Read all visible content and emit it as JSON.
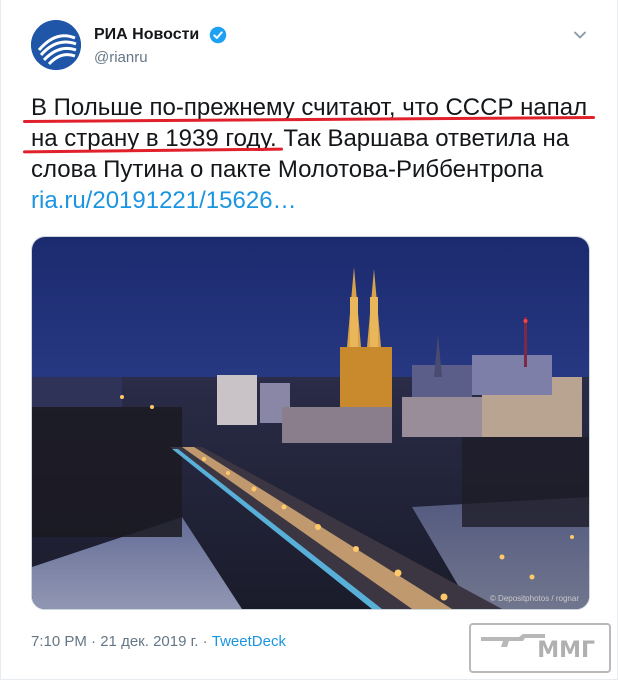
{
  "account": {
    "display_name": "РИА Новости",
    "handle": "@rianru",
    "verified": true
  },
  "tweet": {
    "lines": [
      "В Польше по-прежнему считают, что СССР напал",
      "на страну в 1939 году. Так Варшава ответила на",
      "слова Путина о пакте Молотова-Риббентропа"
    ],
    "link_text": "ria.ru/20191221/15626…"
  },
  "media": {
    "photo_credit": "© Depositphotos / rognar"
  },
  "footer": {
    "time": "7:10 PM",
    "separator": "·",
    "date": "21 дек. 2019 г.",
    "source": "TweetDeck"
  },
  "watermark": {
    "text": "ММГ"
  },
  "colors": {
    "link": "#1b95e0",
    "text": "#14171a",
    "muted": "#657786",
    "underline": "#e0202a",
    "avatar": "#1f56a8"
  }
}
